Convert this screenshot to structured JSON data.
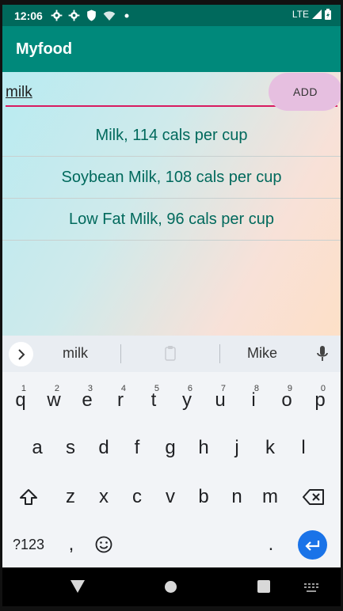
{
  "status_bar": {
    "time": "12:06",
    "network": "LTE"
  },
  "app": {
    "title": "Myfood"
  },
  "search": {
    "value": "milk",
    "add_label": "ADD"
  },
  "foods": [
    {
      "label": "Milk, 114 cals per cup"
    },
    {
      "label": "Soybean Milk, 108 cals per cup"
    },
    {
      "label": "Low Fat Milk, 96 cals per cup"
    }
  ],
  "suggestions": {
    "left": "milk",
    "right": "Mike"
  },
  "keyboard": {
    "row1": [
      "q",
      "w",
      "e",
      "r",
      "t",
      "y",
      "u",
      "i",
      "o",
      "p"
    ],
    "row1_hints": [
      "1",
      "2",
      "3",
      "4",
      "5",
      "6",
      "7",
      "8",
      "9",
      "0"
    ],
    "row2": [
      "a",
      "s",
      "d",
      "f",
      "g",
      "h",
      "j",
      "k",
      "l"
    ],
    "row3": [
      "z",
      "x",
      "c",
      "v",
      "b",
      "n",
      "m"
    ],
    "symbols_label": "?123",
    "comma": ",",
    "period": "."
  },
  "colors": {
    "status_bar": "#00695c",
    "app_bar": "#00897b",
    "list_text": "#00695c",
    "input_underline": "#d81b60",
    "add_button": "#e6bfe0",
    "enter_key": "#1a73e8"
  },
  "icons": [
    "settings-icon",
    "shield-icon",
    "wifi-icon",
    "dot-icon",
    "lte-icon",
    "signal-icon",
    "battery-icon",
    "chevron-right-icon",
    "clipboard-icon",
    "mic-icon",
    "shift-icon",
    "backspace-icon",
    "emoji-icon",
    "enter-icon",
    "nav-back-icon",
    "nav-home-icon",
    "nav-recent-icon",
    "nav-keyboard-icon"
  ]
}
